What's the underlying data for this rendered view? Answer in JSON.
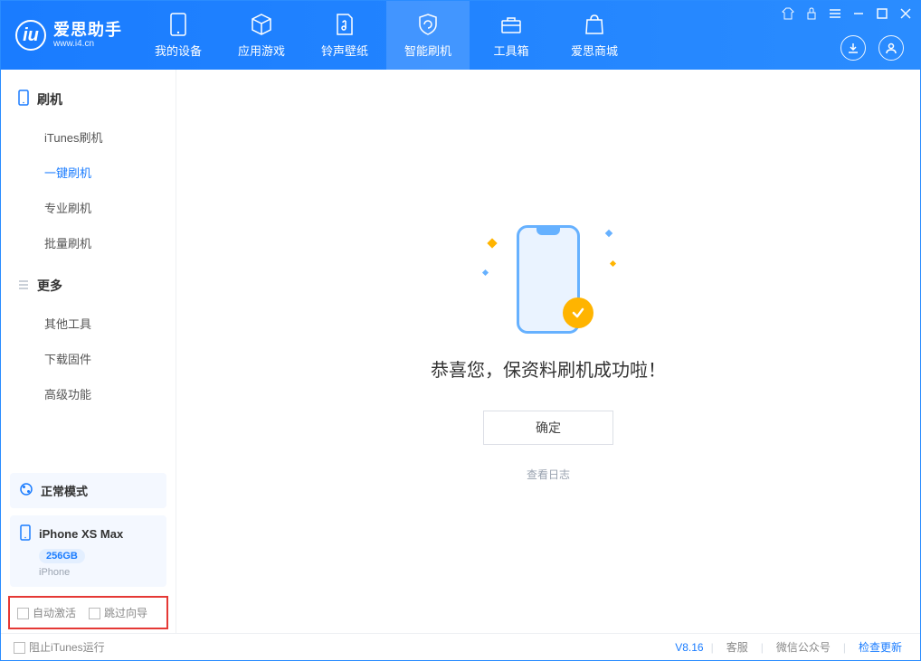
{
  "app": {
    "logo_title": "爱思助手",
    "logo_sub": "www.i4.cn"
  },
  "nav": [
    {
      "label": "我的设备"
    },
    {
      "label": "应用游戏"
    },
    {
      "label": "铃声壁纸"
    },
    {
      "label": "智能刷机"
    },
    {
      "label": "工具箱"
    },
    {
      "label": "爱思商城"
    }
  ],
  "sidebar": {
    "section1_title": "刷机",
    "section1_items": [
      {
        "label": "iTunes刷机"
      },
      {
        "label": "一键刷机",
        "active": true
      },
      {
        "label": "专业刷机"
      },
      {
        "label": "批量刷机"
      }
    ],
    "section2_title": "更多",
    "section2_items": [
      {
        "label": "其他工具"
      },
      {
        "label": "下载固件"
      },
      {
        "label": "高级功能"
      }
    ],
    "mode_label": "正常模式",
    "device_name": "iPhone XS Max",
    "device_storage": "256GB",
    "device_type": "iPhone",
    "checkbox1": "自动激活",
    "checkbox2": "跳过向导"
  },
  "main": {
    "success_msg": "恭喜您，保资料刷机成功啦！",
    "ok_label": "确定",
    "log_link": "查看日志"
  },
  "footer": {
    "block_itunes": "阻止iTunes运行",
    "version": "V8.16",
    "links": [
      {
        "label": "客服"
      },
      {
        "label": "微信公众号"
      },
      {
        "label": "检查更新"
      }
    ]
  }
}
